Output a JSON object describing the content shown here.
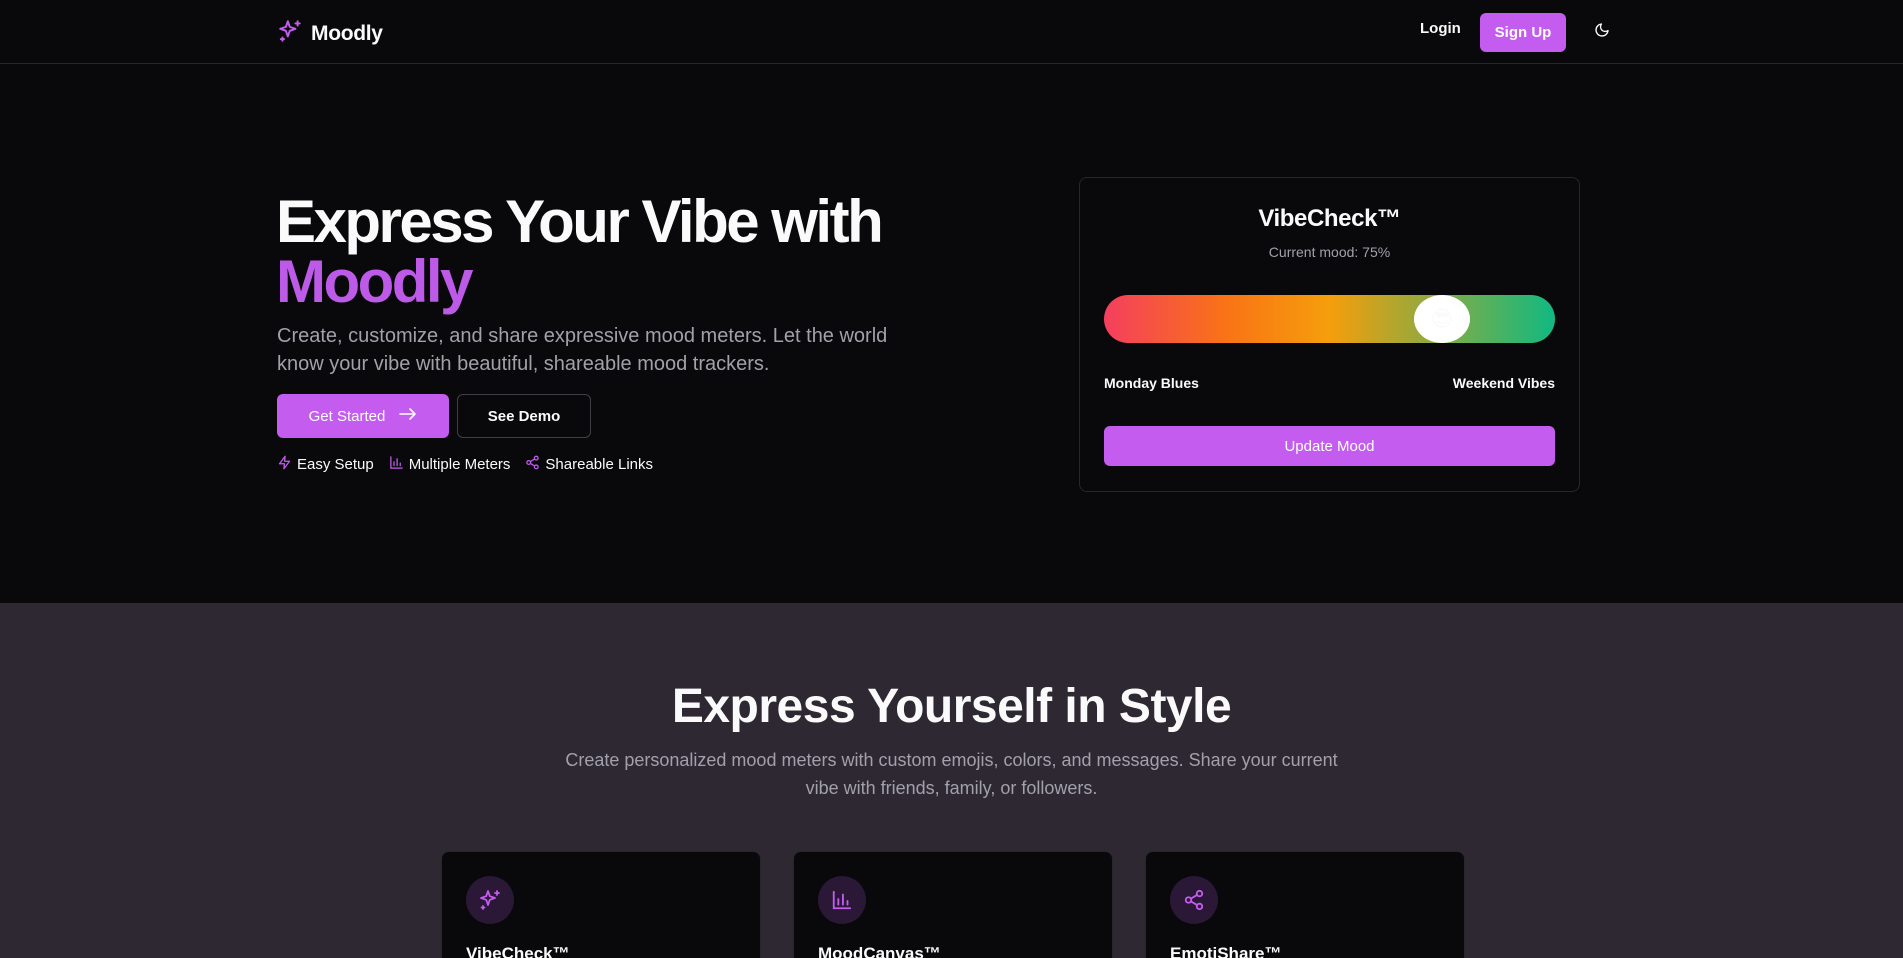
{
  "nav": {
    "brand": "Moodly",
    "login": "Login",
    "signup": "Sign Up"
  },
  "hero": {
    "title_line1": "Express Your Vibe with",
    "title_accent": "Moodly",
    "description": "Create, customize, and share expressive mood meters. Let the world know your vibe with beautiful, shareable mood trackers.",
    "get_started": "Get Started",
    "see_demo": "See Demo",
    "features": [
      "Easy Setup",
      "Multiple Meters",
      "Shareable Links"
    ]
  },
  "vibecheck": {
    "title": "VibeCheck™",
    "subtitle": "Current mood: 75%",
    "mood_level": 0.75,
    "left_label": "Monday Blues",
    "right_label": "Weekend Vibes",
    "update": "Update Mood",
    "emoji": "😎"
  },
  "section": {
    "title": "Express Yourself in Style",
    "description": "Create personalized mood meters with custom emojis, colors, and messages. Share your current vibe with friends, family, or followers.",
    "cards": [
      {
        "title": "VibeCheck™",
        "icon": "sparkles-icon"
      },
      {
        "title": "MoodCanvas™",
        "icon": "bar-chart-icon"
      },
      {
        "title": "EmotiShare™",
        "icon": "share-icon"
      }
    ]
  },
  "colors": {
    "accent": "#c55cf0",
    "background": "#09090b",
    "section_background": "#2e2833",
    "muted_text": "#a1a1aa"
  }
}
